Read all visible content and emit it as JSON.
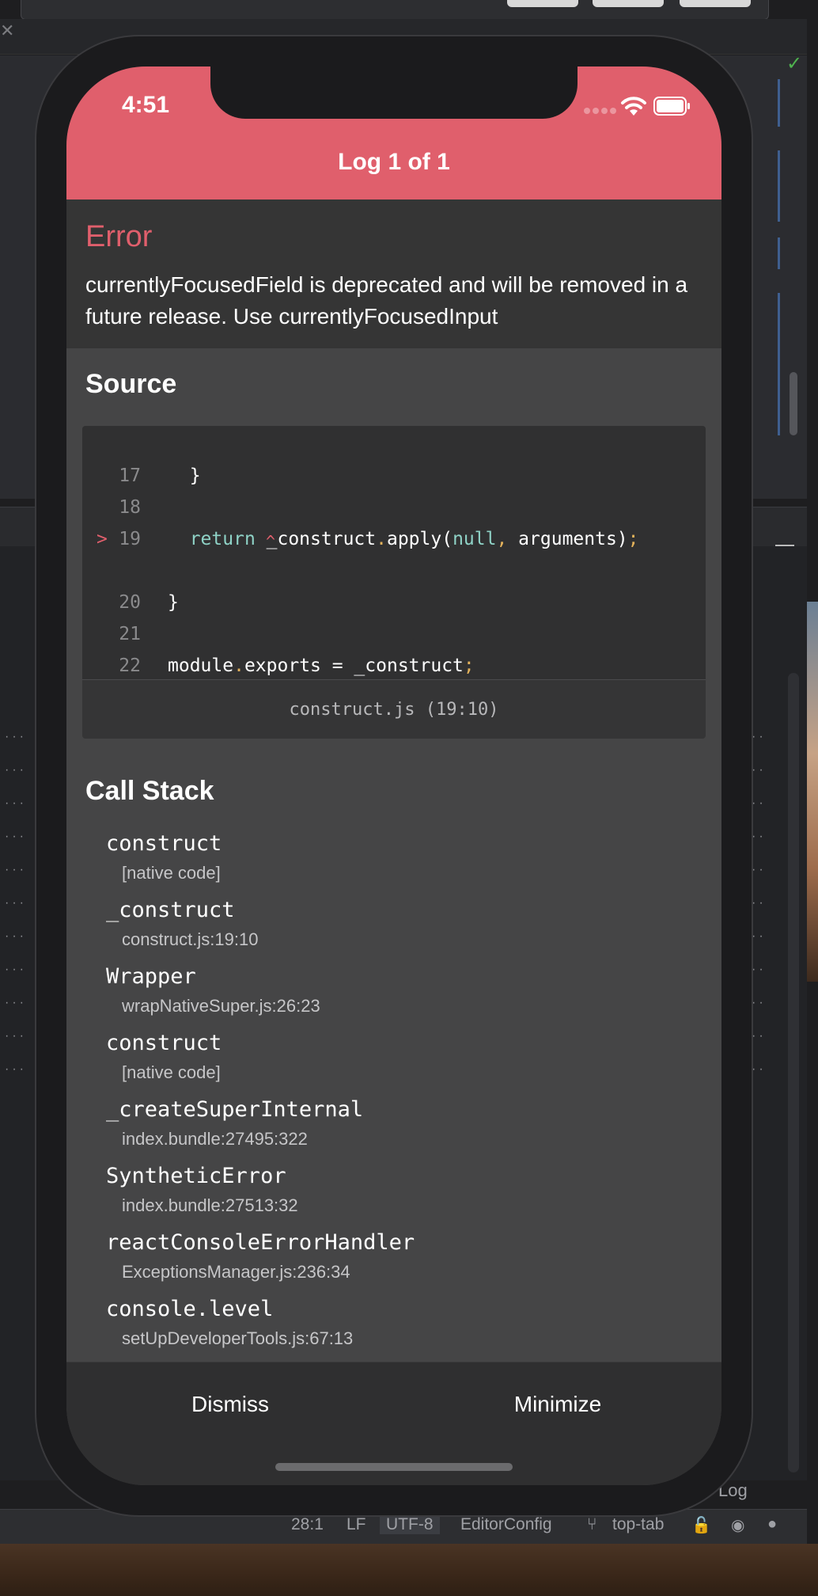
{
  "phone": {
    "time": "4:51",
    "header_title": "Log 1 of 1"
  },
  "error": {
    "label": "Error",
    "message": "currentlyFocusedField is deprecated and will be removed in a future release. Use currentlyFocusedInput"
  },
  "source": {
    "title": "Source",
    "lines": [
      {
        "num": "17",
        "marker": "",
        "text": "  }"
      },
      {
        "num": "18",
        "marker": "",
        "text": ""
      },
      {
        "num": "19",
        "marker": ">",
        "text": "  return _construct.apply(null, arguments);"
      },
      {
        "num": "20",
        "marker": "",
        "text": "}"
      },
      {
        "num": "21",
        "marker": "",
        "text": ""
      },
      {
        "num": "22",
        "marker": "",
        "text": "module.exports = _construct;"
      }
    ],
    "caret": "^",
    "file": "construct.js (19:10)"
  },
  "call_stack": {
    "title": "Call Stack",
    "frames": [
      {
        "name": "construct",
        "location": "[native code]"
      },
      {
        "name": "_construct",
        "location": "construct.js:19:10"
      },
      {
        "name": "Wrapper",
        "location": "wrapNativeSuper.js:26:23"
      },
      {
        "name": "construct",
        "location": "[native code]"
      },
      {
        "name": "_createSuperInternal",
        "location": "index.bundle:27495:322"
      },
      {
        "name": "SyntheticError",
        "location": "index.bundle:27513:32"
      },
      {
        "name": "reactConsoleErrorHandler",
        "location": "ExceptionsManager.js:236:34"
      },
      {
        "name": "console.level",
        "location": "setUpDeveloperTools.js:67:13"
      }
    ]
  },
  "actions": {
    "dismiss": "Dismiss",
    "minimize": "Minimize"
  },
  "ide_status": {
    "position": "28:1",
    "line_ending": "LF",
    "encoding": "UTF-8",
    "config": "EditorConfig",
    "branch": "top-tab",
    "log_tail": "Log"
  },
  "colors": {
    "header": "#e05f6c",
    "error_text": "#e05f6c",
    "keyword": "#8fd3c7",
    "punct": "#e3b25b"
  }
}
